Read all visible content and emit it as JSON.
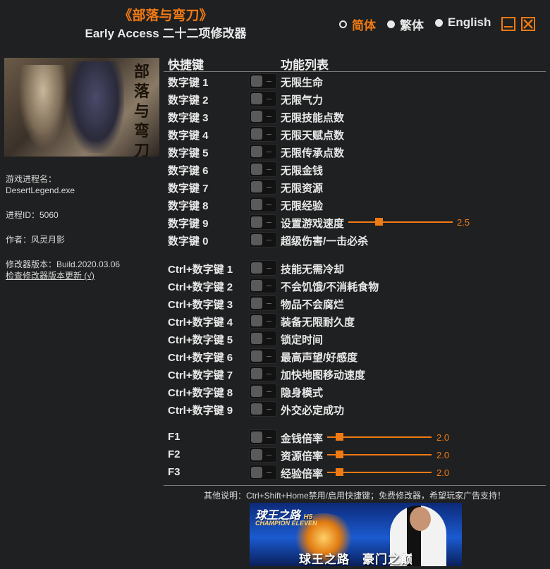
{
  "header": {
    "game_title": "《部落与弯刀》",
    "subtitle": "Early Access 二十二项修改器"
  },
  "languages": [
    {
      "label": "简体",
      "selected": true
    },
    {
      "label": "繁体",
      "selected": false
    },
    {
      "label": "English",
      "selected": false
    }
  ],
  "window_controls": {
    "minimize": "minimize-icon",
    "close": "close-icon"
  },
  "cover": {
    "calligraphy": [
      "部",
      "落",
      "与",
      "弯",
      "刀"
    ]
  },
  "info": {
    "process_label": "游戏进程名：",
    "process_name": "DesertLegend.exe",
    "pid": "进程ID：5060",
    "author": "作者：风灵月影",
    "version": "修改器版本：Build.2020.03.06",
    "update_link": "检查修改器版本更新 (√)"
  },
  "columns": {
    "hotkey": "快捷键",
    "features": "功能列表"
  },
  "cheats": [
    {
      "key": "数字键 1",
      "label": "无限生命"
    },
    {
      "key": "数字键 2",
      "label": "无限气力"
    },
    {
      "key": "数字键 3",
      "label": "无限技能点数"
    },
    {
      "key": "数字键 4",
      "label": "无限天赋点数"
    },
    {
      "key": "数字键 5",
      "label": "无限传承点数"
    },
    {
      "key": "数字键 6",
      "label": "无限金钱"
    },
    {
      "key": "数字键 7",
      "label": "无限资源"
    },
    {
      "key": "数字键 8",
      "label": "无限经验"
    },
    {
      "key": "数字键 9",
      "label": "设置游戏速度",
      "slider_value": "2.5",
      "slider_fraction": 0.26
    },
    {
      "key": "数字键 0",
      "label": "超级伤害/一击必杀"
    },
    {
      "key": "Ctrl+数字键 1",
      "label": "技能无需冷却"
    },
    {
      "key": "Ctrl+数字键 2",
      "label": "不会饥饿/不消耗食物"
    },
    {
      "key": "Ctrl+数字键 3",
      "label": "物品不会腐烂"
    },
    {
      "key": "Ctrl+数字键 4",
      "label": "装备无限耐久度"
    },
    {
      "key": "Ctrl+数字键 5",
      "label": "锁定时间"
    },
    {
      "key": "Ctrl+数字键 6",
      "label": "最高声望/好感度"
    },
    {
      "key": "Ctrl+数字键 7",
      "label": "加快地图移动速度"
    },
    {
      "key": "Ctrl+数字键 8",
      "label": "隐身模式"
    },
    {
      "key": "Ctrl+数字键 9",
      "label": "外交必定成功"
    },
    {
      "key": "F1",
      "label": "金钱倍率",
      "slider_value": "2.0",
      "slider_fraction": 0.08
    },
    {
      "key": "F2",
      "label": "资源倍率",
      "slider_value": "2.0",
      "slider_fraction": 0.08
    },
    {
      "key": "F3",
      "label": "经验倍率",
      "slider_value": "2.0",
      "slider_fraction": 0.08
    }
  ],
  "footer_note": "其他说明：Ctrl+Shift+Home禁用/启用快捷键；免费修改器，希望玩家广告支持！",
  "ad": {
    "logo": "球王之路",
    "logo_badge": "H5",
    "logo_sub": "CHAMPION ELEVEN",
    "slogan": "球王之路　豪门之巅"
  },
  "colors": {
    "accent": "#f07a14",
    "background": "#1f2021"
  }
}
